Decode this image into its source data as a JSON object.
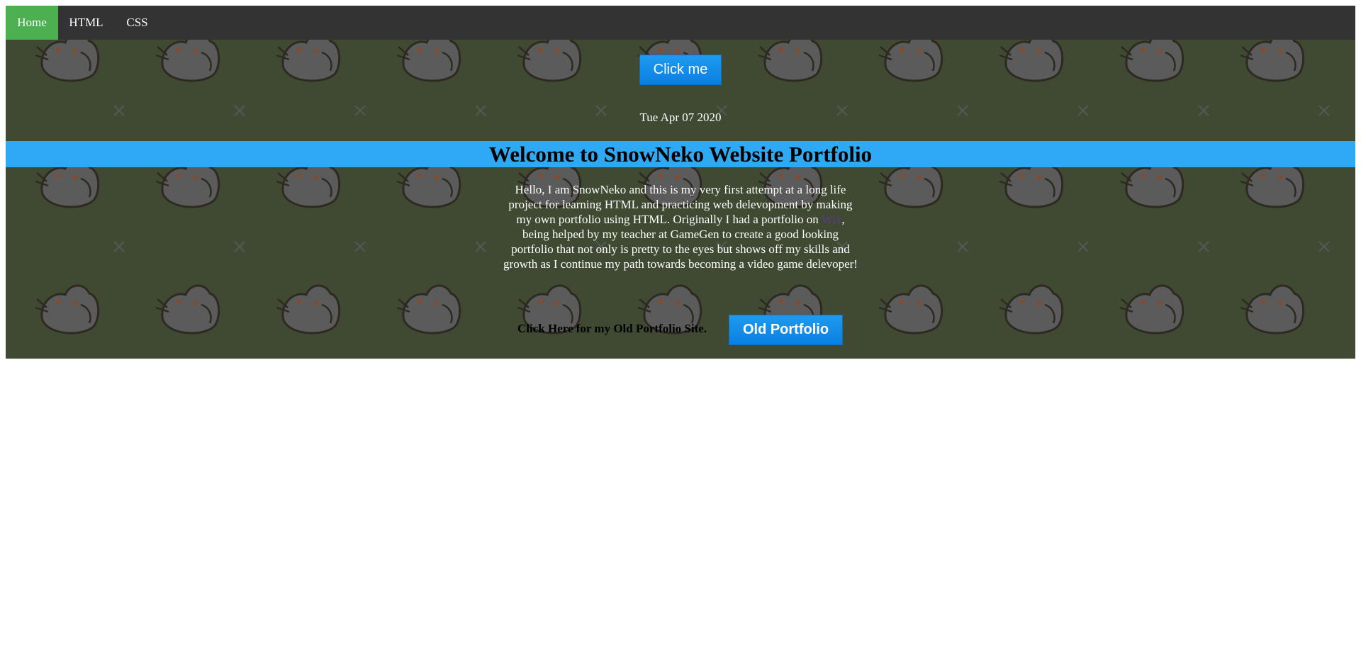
{
  "nav": {
    "items": [
      {
        "label": "Home",
        "active": true
      },
      {
        "label": "HTML",
        "active": false
      },
      {
        "label": "CSS",
        "active": false
      }
    ]
  },
  "hero": {
    "click_button": "Click me",
    "date": "Tue Apr 07 2020"
  },
  "banner": {
    "title": "Welcome to SnowNeko Website Portfolio"
  },
  "intro": {
    "text_before": "Hello, I am SnowNeko and this is my very first attempt at a long life project for learning HTML and practicing web delevopment by making my own portfolio using HTML. Originally I had a portfolio on ",
    "link_text": "Wix",
    "text_after": ", being helped by my teacher at GameGen to create a good looking portfolio that not only is pretty to the eyes but shows off my skills and growth as I continue my path towards becoming a video game delevoper!"
  },
  "old_portfolio": {
    "label": "Click Here for my Old Portfolio Site.",
    "button": "Old Portfolio"
  },
  "colors": {
    "navbar": "#333333",
    "nav_active": "#4caf50",
    "background": "#404a33",
    "banner": "#2eaaf5",
    "button": "#1e9bf0"
  }
}
